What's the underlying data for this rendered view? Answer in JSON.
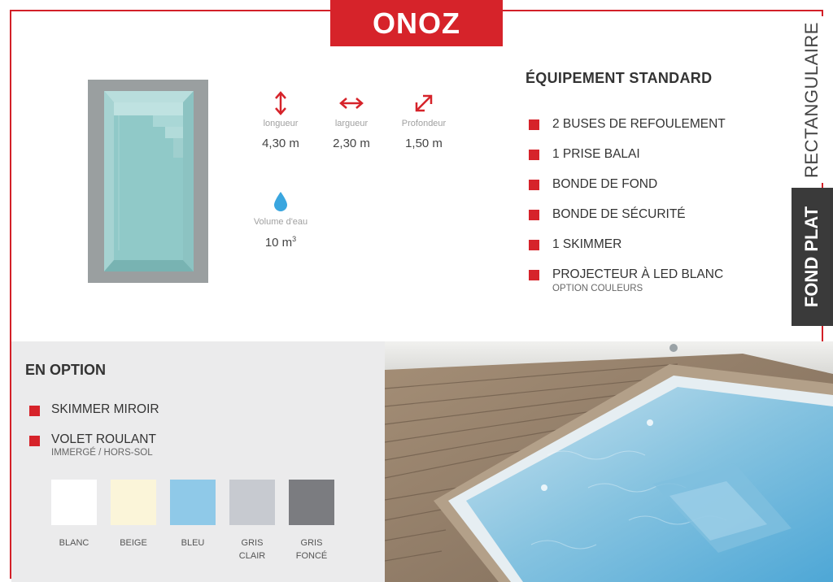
{
  "title": "ONOZ",
  "side_labels": {
    "shape": "RECTANGULAIRE",
    "floor": "FOND PLAT"
  },
  "dimensions": [
    {
      "icon": "vertical-arrow-icon",
      "label": "longueur",
      "value": "4,30 m"
    },
    {
      "icon": "horizontal-arrow-icon",
      "label": "largueur",
      "value": "2,30 m"
    },
    {
      "icon": "diagonal-arrow-icon",
      "label": "Profondeur",
      "value": "1,50 m"
    }
  ],
  "volume": {
    "icon": "water-drop-icon",
    "label": "Volume d'eau",
    "value": "10 m",
    "unit_sup": "3"
  },
  "standard_equipment": {
    "title": "ÉQUIPEMENT STANDARD",
    "items": [
      {
        "label": "2 BUSES DE REFOULEMENT"
      },
      {
        "label": "1 PRISE BALAI"
      },
      {
        "label": "BONDE DE FOND"
      },
      {
        "label": "BONDE DE SÉCURITÉ"
      },
      {
        "label": "1 SKIMMER"
      },
      {
        "label": "PROJECTEUR À LED BLANC",
        "sub": "OPTION COULEURS"
      }
    ]
  },
  "options": {
    "title": "EN OPTION",
    "items": [
      {
        "label": "SKIMMER MIROIR"
      },
      {
        "label": "VOLET ROULANT",
        "sub": "IMMERGÉ / HORS-SOL"
      }
    ]
  },
  "colors": [
    {
      "name": "BLANC",
      "hex": "#ffffff"
    },
    {
      "name": "BEIGE",
      "hex": "#fbf5d9"
    },
    {
      "name": "BLEU",
      "hex": "#8fc9e8"
    },
    {
      "name": "GRIS\nCLAIR",
      "hex": "#c7cad0"
    },
    {
      "name": "GRIS\nFONCÉ",
      "hex": "#7b7c80"
    }
  ],
  "accent_color": "#d6232a"
}
